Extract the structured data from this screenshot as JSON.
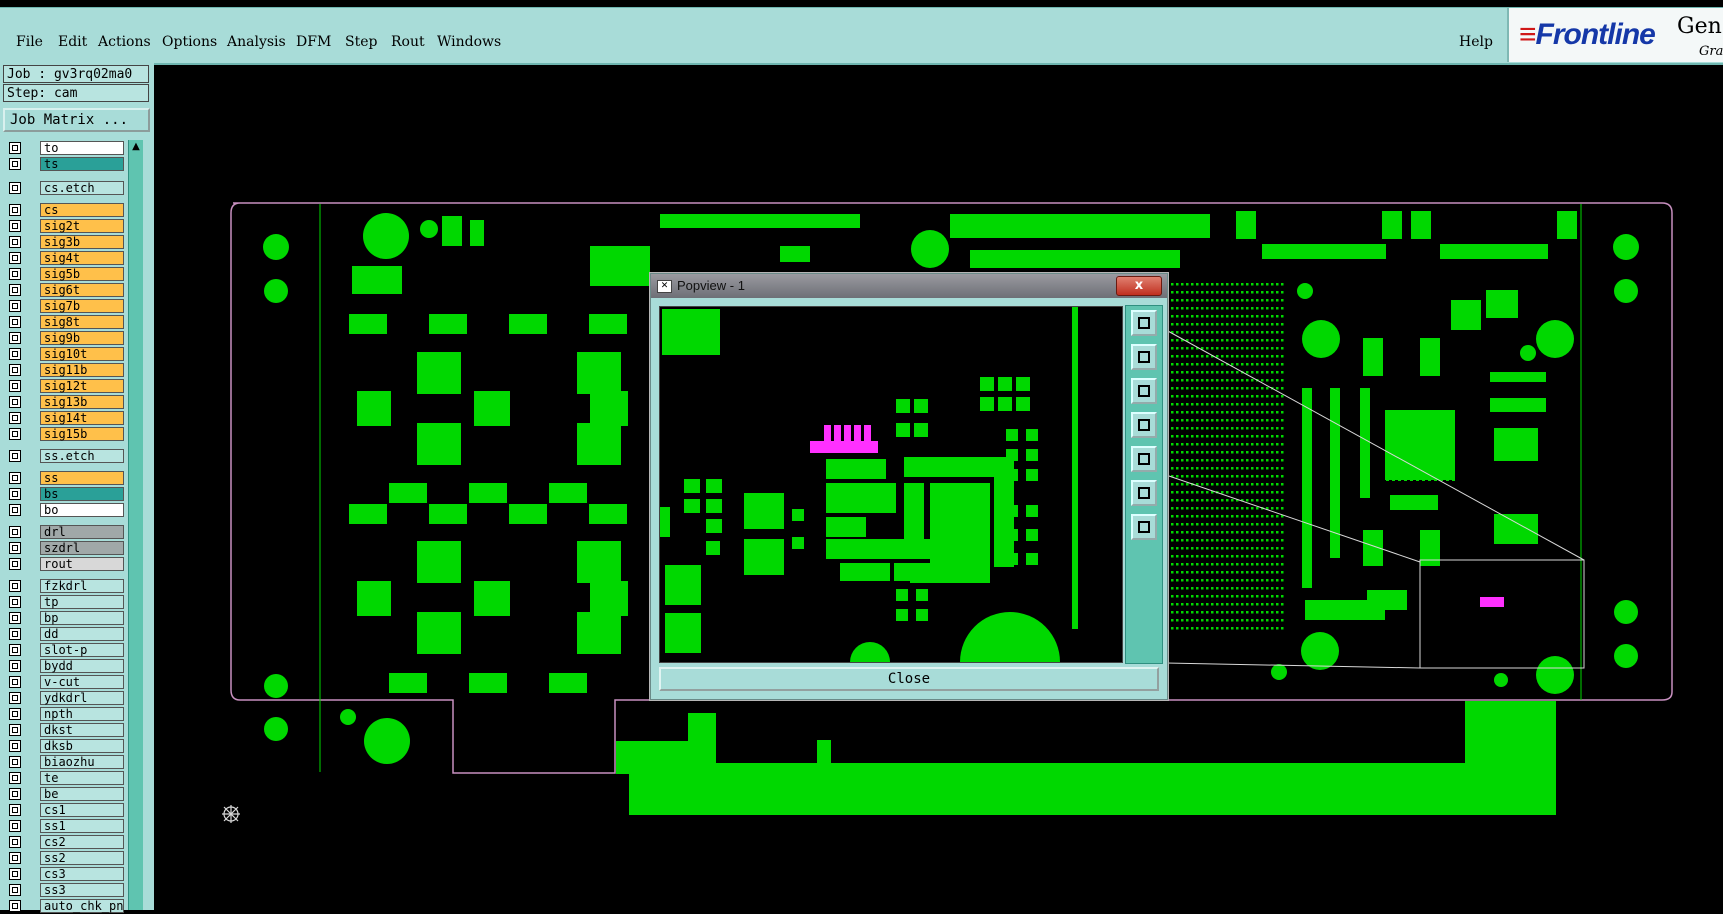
{
  "menu": {
    "items": [
      "File",
      "Edit",
      "Actions",
      "Options",
      "Analysis",
      "DFM",
      "Step",
      "Rout",
      "Windows"
    ],
    "help": "Help"
  },
  "brand": {
    "logo_text": "Frontline",
    "product_text": "Gen",
    "subtitle_text": "Gra"
  },
  "job": {
    "job_label": "Job : gv3rq02ma0",
    "step_label": "Step: cam",
    "matrix_button": "Job Matrix ..."
  },
  "layers": [
    {
      "name": "to",
      "color": "#ffffff"
    },
    {
      "name": "ts",
      "color": "#2aa098"
    },
    {
      "name": "cs.etch",
      "color": "#b8e4e0"
    },
    {
      "name": "cs",
      "color": "#ffc04a"
    },
    {
      "name": "sig2t",
      "color": "#ffc04a"
    },
    {
      "name": "sig3b",
      "color": "#ffc04a"
    },
    {
      "name": "sig4t",
      "color": "#ffc04a"
    },
    {
      "name": "sig5b",
      "color": "#ffc04a"
    },
    {
      "name": "sig6t",
      "color": "#ffc04a"
    },
    {
      "name": "sig7b",
      "color": "#ffc04a"
    },
    {
      "name": "sig8t",
      "color": "#ffc04a"
    },
    {
      "name": "sig9b",
      "color": "#ffc04a"
    },
    {
      "name": "sig10t",
      "color": "#ffc04a"
    },
    {
      "name": "sig11b",
      "color": "#ffc04a"
    },
    {
      "name": "sig12t",
      "color": "#ffc04a"
    },
    {
      "name": "sig13b",
      "color": "#ffc04a"
    },
    {
      "name": "sig14t",
      "color": "#ffc04a"
    },
    {
      "name": "sig15b",
      "color": "#ffc04a"
    },
    {
      "name": "ss.etch",
      "color": "#b8e4e0"
    },
    {
      "name": "ss",
      "color": "#ffc04a"
    },
    {
      "name": "bs",
      "color": "#2aa098"
    },
    {
      "name": "bo",
      "color": "#ffffff"
    },
    {
      "name": "drl",
      "color": "#a0a8a8"
    },
    {
      "name": "szdrl",
      "color": "#a0a8a8"
    },
    {
      "name": "rout",
      "color": "#d8d8d8"
    },
    {
      "name": "fzkdrl",
      "color": "#b8e4e0"
    },
    {
      "name": "tp",
      "color": "#b8e4e0"
    },
    {
      "name": "bp",
      "color": "#b8e4e0"
    },
    {
      "name": "dd",
      "color": "#b8e4e0"
    },
    {
      "name": "slot-p",
      "color": "#b8e4e0"
    },
    {
      "name": "bydd",
      "color": "#b8e4e0"
    },
    {
      "name": "v-cut",
      "color": "#b8e4e0"
    },
    {
      "name": "ydkdrl",
      "color": "#b8e4e0"
    },
    {
      "name": "npth",
      "color": "#b8e4e0"
    },
    {
      "name": "dkst",
      "color": "#b8e4e0"
    },
    {
      "name": "dksb",
      "color": "#b8e4e0"
    },
    {
      "name": "biaozhu",
      "color": "#b8e4e0"
    },
    {
      "name": "te",
      "color": "#b8e4e0"
    },
    {
      "name": "be",
      "color": "#b8e4e0"
    },
    {
      "name": "cs1",
      "color": "#b8e4e0"
    },
    {
      "name": "ss1",
      "color": "#b8e4e0"
    },
    {
      "name": "cs2",
      "color": "#b8e4e0"
    },
    {
      "name": "ss2",
      "color": "#b8e4e0"
    },
    {
      "name": "cs3",
      "color": "#b8e4e0"
    },
    {
      "name": "ss3",
      "color": "#b8e4e0"
    },
    {
      "name": "auto_chk_pn",
      "color": "#b8e4e0"
    }
  ],
  "popview": {
    "title": "Popview - 1",
    "close_x": "x",
    "close_button": "Close"
  },
  "colors": {
    "pcb_copper": "#00d800",
    "outline": "#c890c0",
    "highlight": "#ff30ff"
  }
}
